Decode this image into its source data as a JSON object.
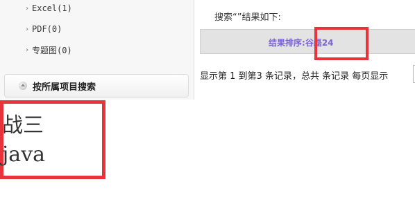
{
  "sidebar": {
    "items": [
      {
        "label": "Excel(1)",
        "icon": "chevron-right-icon"
      },
      {
        "label": "PDF(0)",
        "icon": "chevron-right-icon"
      },
      {
        "label": "专题图(0)",
        "icon": "chevron-right-icon"
      }
    ],
    "group_header": {
      "label": "按所属项目搜索",
      "icon": "collapse-bullet-icon"
    }
  },
  "search": {
    "title": "搜索“”结果如下:"
  },
  "sort_bar": {
    "label": "结果排序:",
    "value": "谷磊24"
  },
  "records": {
    "text": "显示第 1 到第3 条记录，总共 条记录 每页显示"
  },
  "results": [
    {
      "text": "战三"
    },
    {
      "text": "java"
    }
  ],
  "colors": {
    "highlight": "#e8333b",
    "sort_text": "#7a64d6",
    "sort_bar_bg": "#e3e3e3",
    "sidebar_bg": "#f7f7f7"
  }
}
